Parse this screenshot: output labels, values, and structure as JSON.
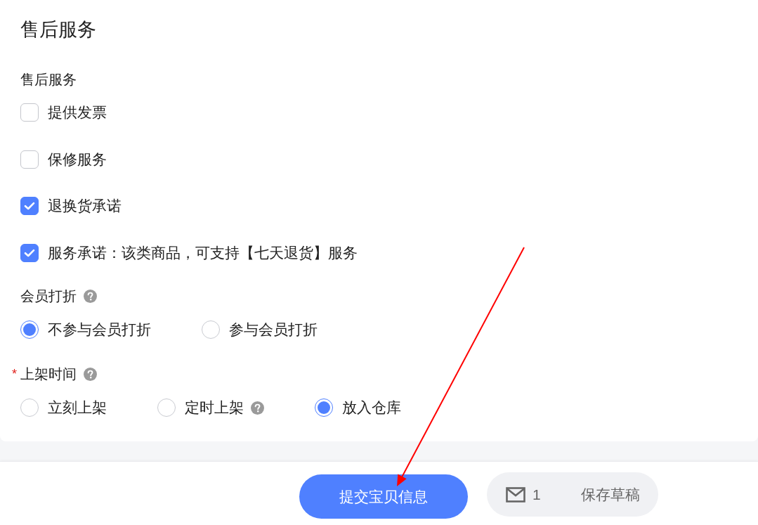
{
  "section": {
    "title": "售后服务"
  },
  "after_sales": {
    "label": "售后服务",
    "options": [
      {
        "label": "提供发票",
        "checked": false
      },
      {
        "label": "保修服务",
        "checked": false
      },
      {
        "label": "退换货承诺",
        "checked": true
      },
      {
        "label": "服务承诺：该类商品，可支持【七天退货】服务",
        "checked": true
      }
    ]
  },
  "member_discount": {
    "label": "会员打折",
    "help": true,
    "options": [
      {
        "label": "不参与会员打折",
        "selected": true,
        "help": false
      },
      {
        "label": "参与会员打折",
        "selected": false,
        "help": false
      }
    ]
  },
  "listing_time": {
    "required_mark": "*",
    "label": "上架时间",
    "help": true,
    "options": [
      {
        "label": "立刻上架",
        "selected": false,
        "help": false
      },
      {
        "label": "定时上架",
        "selected": false,
        "help": true
      },
      {
        "label": "放入仓库",
        "selected": true,
        "help": false
      }
    ]
  },
  "footer": {
    "submit_button": "提交宝贝信息",
    "draft_button": {
      "count": "1",
      "label": "保存草稿"
    }
  }
}
